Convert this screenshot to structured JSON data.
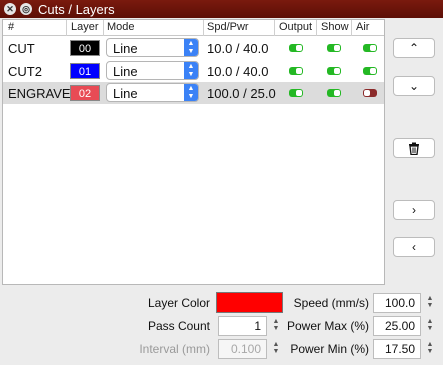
{
  "window": {
    "title": "Cuts / Layers"
  },
  "columns": [
    "#",
    "Layer",
    "Mode",
    "Spd/Pwr",
    "Output",
    "Show",
    "Air"
  ],
  "rows": [
    {
      "name": "CUT",
      "layer": "00",
      "layer_color": "#000000",
      "mode": "Line",
      "spd_pwr": "10.0 / 40.0",
      "output": true,
      "show": true,
      "air": true,
      "selected": false
    },
    {
      "name": "CUT2",
      "layer": "01",
      "layer_color": "#0000ff",
      "mode": "Line",
      "spd_pwr": "10.0 / 40.0",
      "output": true,
      "show": true,
      "air": true,
      "selected": false
    },
    {
      "name": "ENGRAVE",
      "layer": "02",
      "layer_color": "#e84b55",
      "mode": "Line",
      "spd_pwr": "100.0 / 25.0",
      "output": true,
      "show": true,
      "air": false,
      "selected": true
    }
  ],
  "side_buttons": {
    "up": "⌃",
    "down": "⌄",
    "delete": "trash-icon",
    "next": "›",
    "prev": "‹"
  },
  "settings": {
    "layer_color_label": "Layer Color",
    "layer_color": "#ff0000",
    "pass_count_label": "Pass Count",
    "pass_count": "1",
    "interval_label": "Interval (mm)",
    "interval": "0.100",
    "speed_label": "Speed (mm/s)",
    "speed": "100.0",
    "power_max_label": "Power Max (%)",
    "power_max": "25.00",
    "power_min_label": "Power Min (%)",
    "power_min": "17.50"
  }
}
